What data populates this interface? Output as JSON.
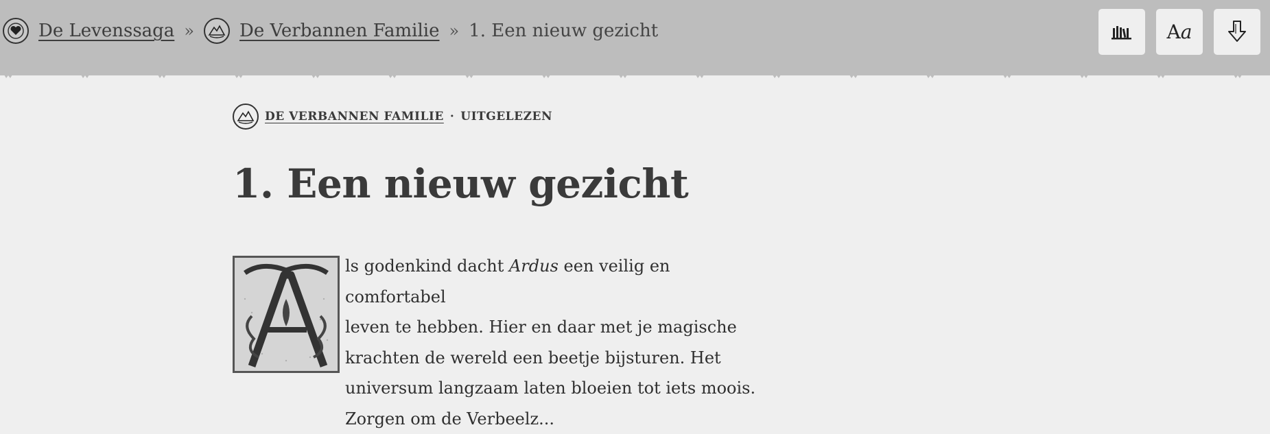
{
  "breadcrumb": {
    "root": {
      "label": "De Levenssaga",
      "icon": "heart-emblem-icon"
    },
    "separator": "»",
    "book": {
      "label": "De Verbannen Familie",
      "icon": "mountain-emblem-icon"
    },
    "current": "1. Een nieuw gezicht"
  },
  "toolbar": {
    "library_icon": "library-books-icon",
    "typography_label_a": "A",
    "typography_label_b": "a",
    "download_icon": "download-arrow-icon"
  },
  "meta": {
    "book_label": "DE VERBANNEN FAMILIE",
    "dot": "·",
    "status": "UITGELEZEN"
  },
  "chapter": {
    "title": "1. Een nieuw gezicht",
    "dropcap_letter": "A",
    "line1_before": "ls godenkind dacht ",
    "line1_italic": "Ardus",
    "line1_after": " een veilig en comfortabel",
    "line2": "leven te hebben. Hier en daar met je magische",
    "line3": "krachten de wereld een beetje bijsturen. Het",
    "line4": "universum langzaam laten bloeien tot iets moois.",
    "line5": "Zorgen om de Verbeelz..."
  },
  "colors": {
    "header_bg": "#bdbdbd",
    "page_bg": "#efefef",
    "text": "#3a3a3a"
  }
}
